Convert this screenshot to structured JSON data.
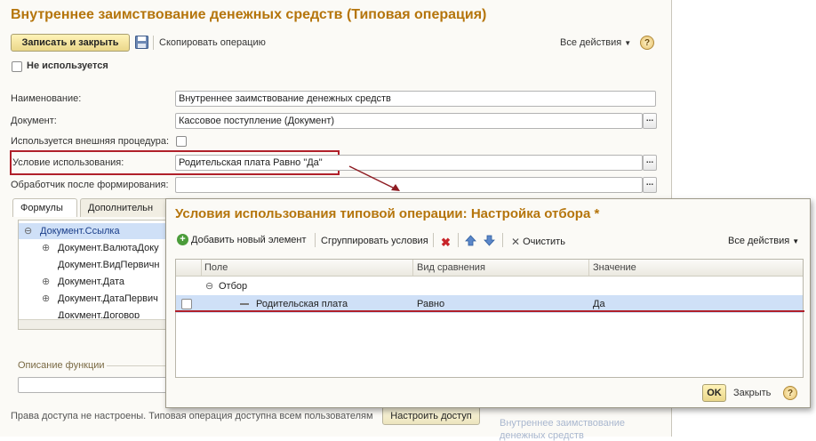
{
  "main": {
    "title": "Внутреннее заимствование денежных средств (Типовая операция)",
    "toolbar": {
      "save_close": "Записать и закрыть",
      "copy": "Скопировать операцию",
      "all_actions": "Все действия",
      "help": "?"
    },
    "not_used_label": "Не используется",
    "form": {
      "name_label": "Наименование:",
      "name_value": "Внутреннее заимствование денежных средств",
      "document_label": "Документ:",
      "document_value": "Кассовое поступление (Документ)",
      "external_proc_label": "Используется внешняя процедура:",
      "condition_label": "Условие использования:",
      "condition_value": "Родительская плата Равно \"Да\"",
      "handler_label": "Обработчик после формирования:",
      "handler_value": "",
      "dots": "..."
    },
    "tabs": [
      {
        "label": "Формулы"
      },
      {
        "label": "Дополнительн"
      }
    ],
    "tree": [
      {
        "label": "Документ.Ссылка",
        "expander": "⊖"
      },
      {
        "label": "Документ.ВалютаДоку",
        "expander": "⊕"
      },
      {
        "label": "Документ.ВидПервичн",
        "expander": ""
      },
      {
        "label": "Документ.Дата",
        "expander": "⊕"
      },
      {
        "label": "Документ.ДатаПервич",
        "expander": "⊕"
      },
      {
        "label": "Документ.Договор",
        "expander": ""
      }
    ],
    "function_desc_label": "Описание функции",
    "access_text": "Права доступа не настроены. Типовая операция доступна всем пользователям",
    "access_button": "Настроить доступ",
    "bg_text_line1": "Внутреннее заимствование",
    "bg_text_line2": "денежных средств"
  },
  "dialog": {
    "title": "Условия использования типовой операции: Настройка отбора *",
    "toolbar": {
      "add": "Добавить новый элемент",
      "group": "Сгруппировать условия",
      "clear": "Очистить",
      "all_actions": "Все действия"
    },
    "columns": {
      "field": "Поле",
      "compare": "Вид сравнения",
      "value": "Значение"
    },
    "rows": [
      {
        "field": "Отбор",
        "compare": "",
        "value": ""
      },
      {
        "field": "Родительская плата",
        "compare": "Равно",
        "value": "Да"
      }
    ],
    "ok": "OK",
    "close": "Закрыть",
    "help": "?"
  },
  "colors": {
    "title": "#b5750c",
    "highlight_border": "#b0202a",
    "selected_row": "#cfe0f7"
  }
}
